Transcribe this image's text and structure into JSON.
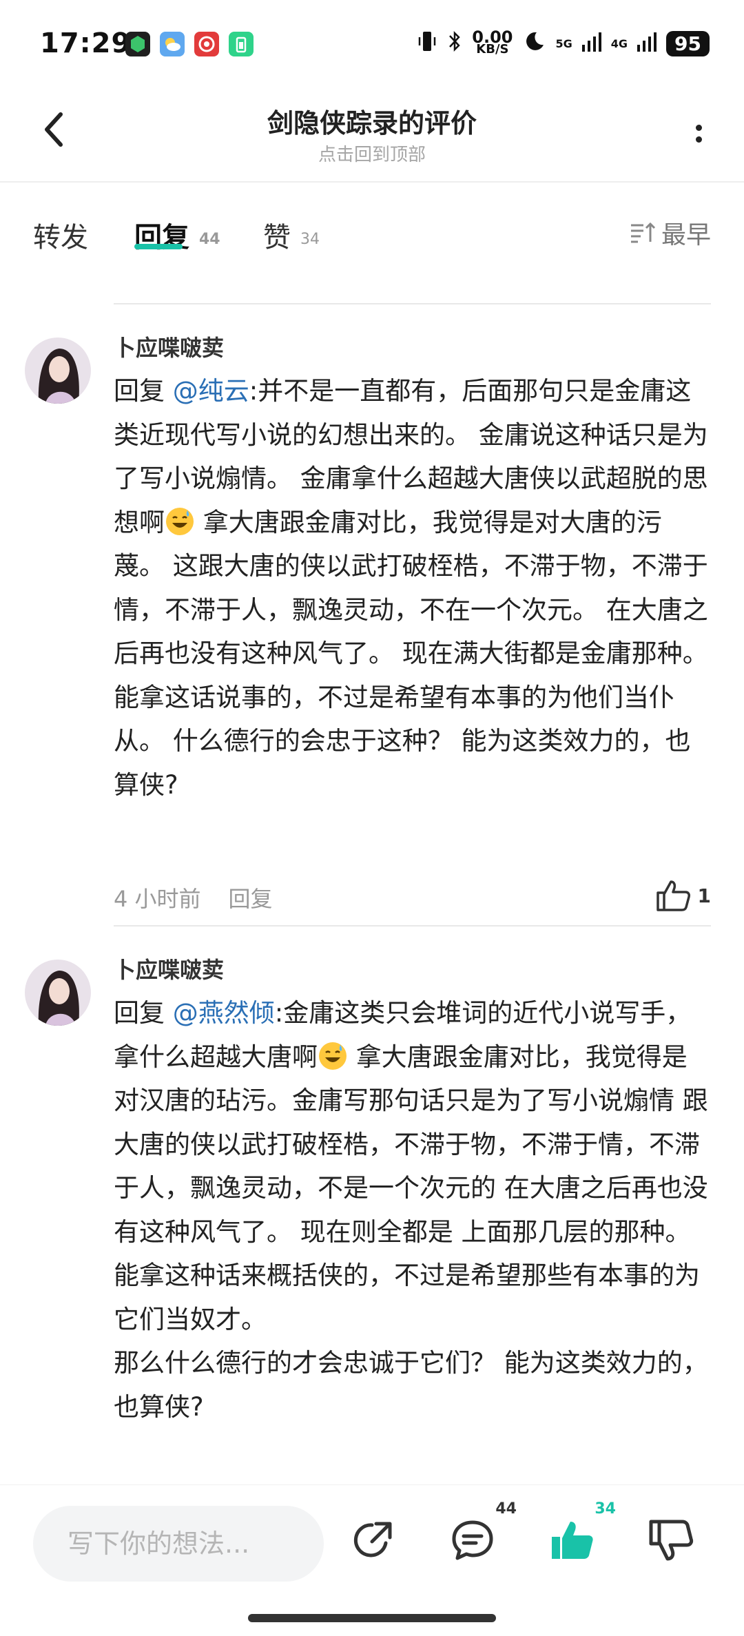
{
  "status": {
    "time": "17:29",
    "speed_value": "0.00",
    "speed_unit": "KB/S",
    "net1": "5G",
    "net2": "4G",
    "battery": "95"
  },
  "header": {
    "title": "剑隐侠踪录的评价",
    "subtitle": "点击回到顶部"
  },
  "tabs": [
    {
      "label": "转发",
      "count": ""
    },
    {
      "label": "回复",
      "count": "44"
    },
    {
      "label": "赞",
      "count": "34"
    }
  ],
  "sort_label": "最早",
  "comments": [
    {
      "author": "卜应喋啵荬",
      "reply_prefix": "回复 ",
      "mention": "@纯云",
      "text_a": ":并不是一直都有，后面那句只是金庸这类近现代写小说的幻想出来的。 金庸说这种话只是为了写小说煽情。 金庸拿什么超越大唐侠以武超脱的思想啊",
      "text_b": " 拿大唐跟金庸对比，我觉得是对大唐的污蔑。 这跟大唐的侠以武打破桎梏，不滞于物，不滞于情，不滞于人，飘逸灵动，不在一个次元。 在大唐之后再也没有这种风气了。 现在满大街都是金庸那种。 能拿这话说事的，不过是希望有本事的为他们当仆从。 什么德行的会忠于这种？ 能为这类效力的，也算侠?",
      "time": "4 小时前",
      "reply_label": "回复",
      "likes": "1"
    },
    {
      "author": "卜应喋啵荬",
      "reply_prefix": "回复 ",
      "mention": "@燕然倾",
      "text_a": ":金庸这类只会堆词的近代小说写手，拿什么超越大唐啊",
      "text_b": " 拿大唐跟金庸对比，我觉得是对汉唐的玷污。金庸写那句话只是为了写小说煽情 跟大唐的侠以武打破桎梏，不滞于物，不滞于情，不滞于人，飘逸灵动，不是一个次元的 在大唐之后再也没有这种风气了。 现在则全都是 上面那几层的那种。 能拿这种话来概括侠的，不过是希望那些有本事的为它们当奴才。",
      "text_c": "那么什么德行的才会忠诚于它们？ 能为这类效力的，也算侠?"
    }
  ],
  "bottom": {
    "input_placeholder": "写下你的想法...",
    "comment_count": "44",
    "like_count": "34"
  },
  "colors": {
    "accent": "#19c2a8",
    "mention": "#2a6fb5"
  }
}
